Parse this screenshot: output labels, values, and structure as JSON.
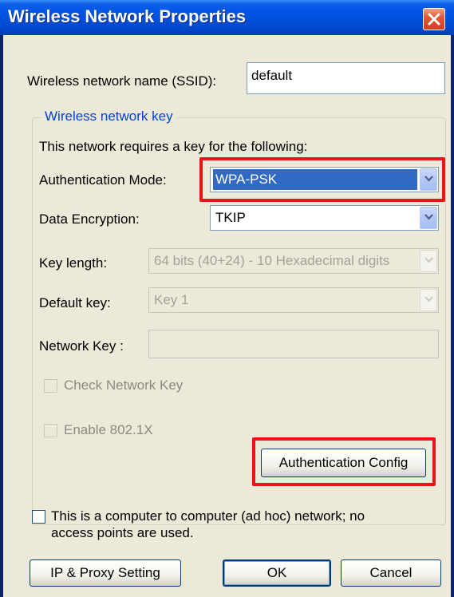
{
  "window": {
    "title": "Wireless Network Properties"
  },
  "ssid": {
    "label": "Wireless network name (SSID):",
    "value": "default"
  },
  "group": {
    "legend": "Wireless network key",
    "intro": "This network requires a key for the following:"
  },
  "auth_mode": {
    "label": "Authentication Mode:",
    "value": "WPA-PSK"
  },
  "encryption": {
    "label": "Data Encryption:",
    "value": "TKIP"
  },
  "key_length": {
    "label": "Key length:",
    "value": "64 bits (40+24) - 10 Hexadecimal digits"
  },
  "default_key": {
    "label": "Default key:",
    "value": "Key 1"
  },
  "network_key": {
    "label": "Network Key :",
    "value": ""
  },
  "check_network_key": {
    "label": "Check Network Key",
    "checked": false
  },
  "enable_8021x": {
    "label": "Enable 802.1X",
    "checked": false
  },
  "buttons": {
    "auth_config": "Authentication Config",
    "ip_proxy": "IP & Proxy Setting",
    "ok": "OK",
    "cancel": "Cancel"
  },
  "adhoc": {
    "label_line1": "This is a computer to computer (ad hoc) network; no",
    "label_line2": "access points are used.",
    "checked": false
  },
  "colors": {
    "highlight": "#e8141c",
    "titlebar": "#0054e3",
    "selection": "#316ac5"
  }
}
